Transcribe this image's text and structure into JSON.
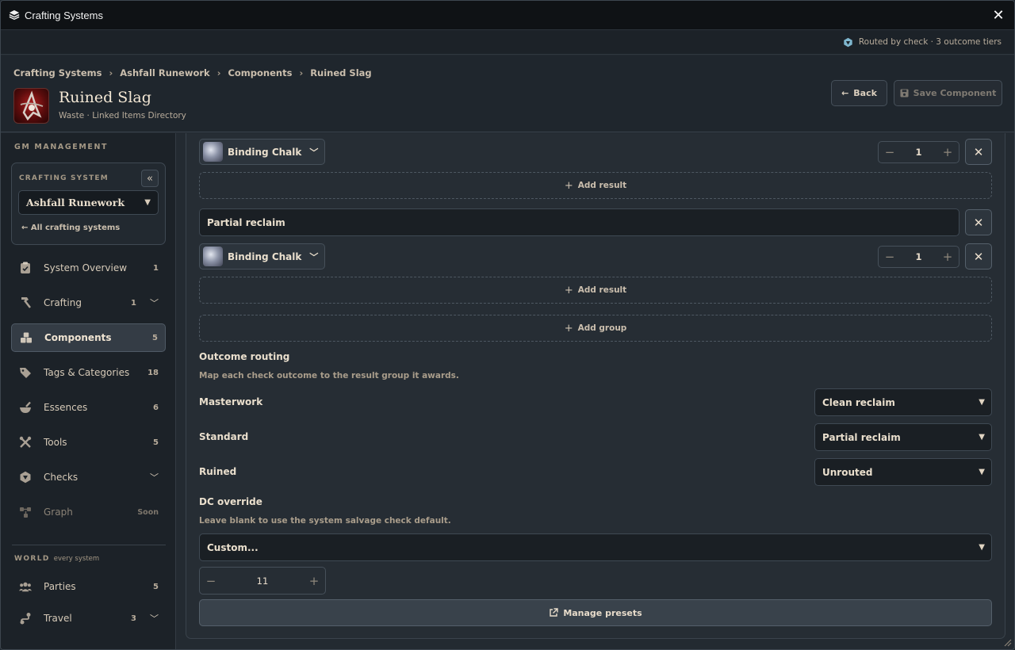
{
  "window": {
    "title": "Crafting Systems",
    "close_label": "✕"
  },
  "subbar": {
    "routing_text": "Routed by check · 3 outcome tiers"
  },
  "breadcrumb": [
    "Crafting Systems",
    "Ashfall Runework",
    "Components",
    "Ruined Slag"
  ],
  "header": {
    "title": "Ruined Slag",
    "subtitle": "Waste · Linked Items Directory",
    "back_label": "Back",
    "save_label": "Save Component"
  },
  "sidebar": {
    "heading": "GM MANAGEMENT",
    "crafting_system_label": "CRAFTING SYSTEM",
    "crafting_system_value": "Ashfall Runework",
    "all_systems_label": "All crafting systems",
    "items": [
      {
        "label": "System Overview",
        "count": "1",
        "icon": "clipboard-icon"
      },
      {
        "label": "Crafting",
        "count": "1",
        "icon": "hammer-icon",
        "expandable": true
      },
      {
        "label": "Components",
        "count": "5",
        "icon": "boxes-icon",
        "active": true
      },
      {
        "label": "Tags & Categories",
        "count": "18",
        "icon": "tags-icon"
      },
      {
        "label": "Essences",
        "count": "6",
        "icon": "mortar-icon"
      },
      {
        "label": "Tools",
        "count": "5",
        "icon": "tools-icon"
      },
      {
        "label": "Checks",
        "count": "",
        "icon": "dice-icon",
        "expandable": true
      },
      {
        "label": "Graph",
        "badge": "Soon",
        "icon": "graph-icon",
        "disabled": true
      }
    ],
    "world_heading": "WORLD",
    "world_sub": "every system",
    "world_items": [
      {
        "label": "Parties",
        "count": "5",
        "icon": "users-icon"
      },
      {
        "label": "Travel",
        "count": "3",
        "icon": "route-icon",
        "expandable": true
      }
    ]
  },
  "main": {
    "result_rows": [
      {
        "item": "Binding Chalk",
        "quantity": "1"
      },
      {
        "item": "Binding Chalk",
        "quantity": "1"
      }
    ],
    "add_result_label": "Add result",
    "group_name": "Partial reclaim",
    "add_group_label": "Add group",
    "outcome_routing": {
      "title": "Outcome routing",
      "description": "Map each check outcome to the result group it awards.",
      "rows": [
        {
          "outcome": "Masterwork",
          "group": "Clean reclaim"
        },
        {
          "outcome": "Standard",
          "group": "Partial reclaim"
        },
        {
          "outcome": "Ruined",
          "group": "Unrouted"
        }
      ]
    },
    "dc_override": {
      "title": "DC override",
      "description": "Leave blank to use the system salvage check default.",
      "select_value": "Custom...",
      "value": "11"
    },
    "manage_presets_label": "Manage presets"
  },
  "colors": {
    "background": "#232a31",
    "panel": "#262d34",
    "accent_text": "#eadfcd",
    "active_nav": "#343c45"
  }
}
